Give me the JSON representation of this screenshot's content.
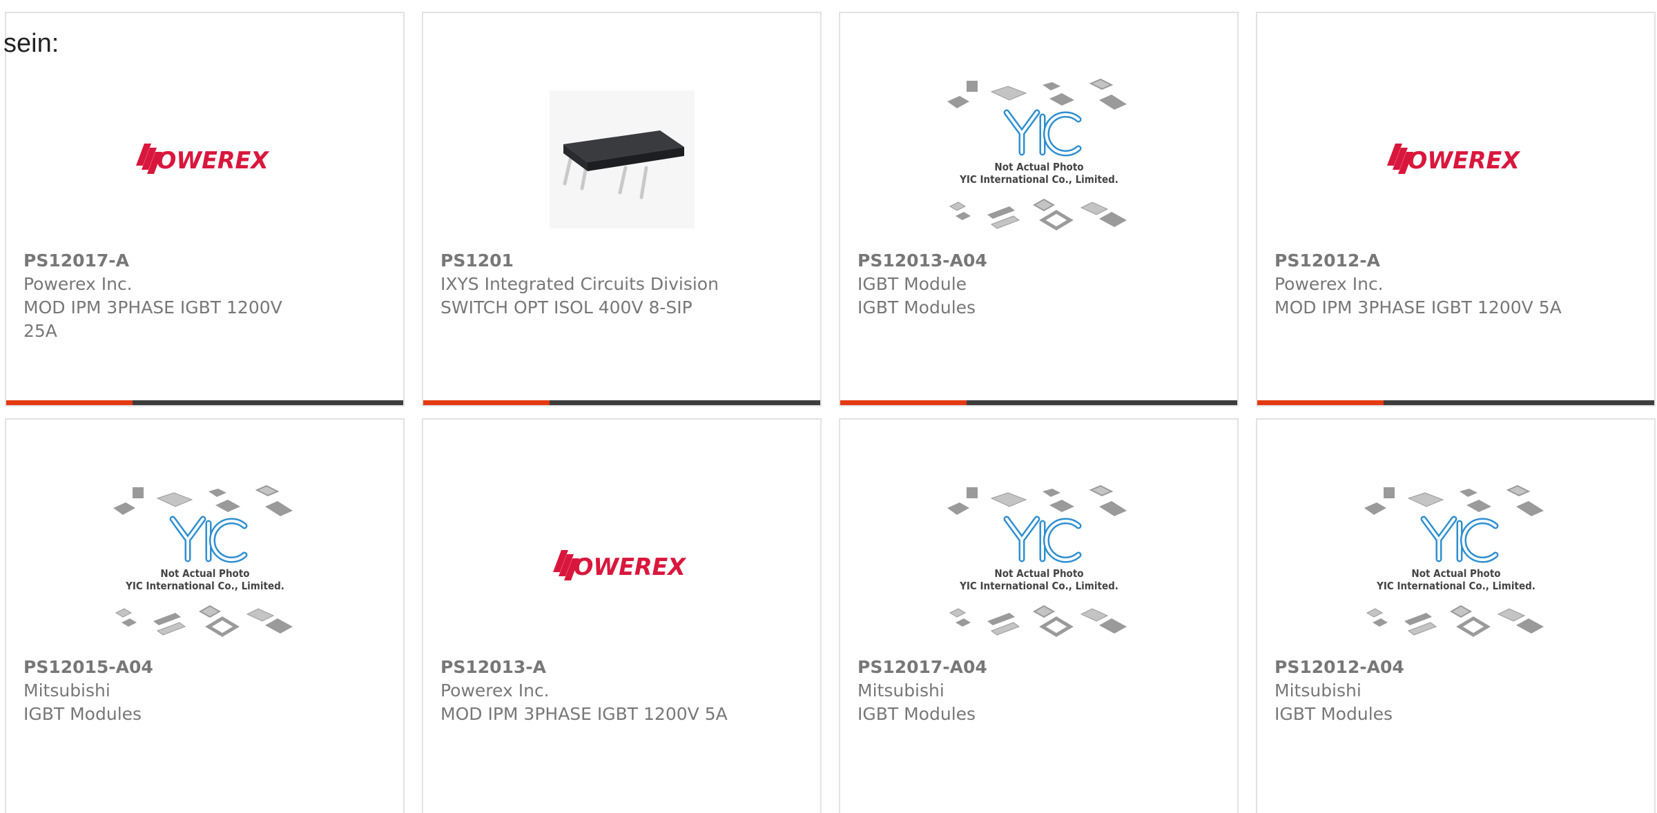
{
  "leading_text": "sein:",
  "products": [
    {
      "part": "PS12017-A",
      "lines": [
        "Powerex Inc.",
        "MOD IPM 3PHASE IGBT 1200V",
        "25A"
      ],
      "image": "powerex-logo",
      "image_text": "POWEREX"
    },
    {
      "part": "PS1201",
      "lines": [
        "IXYS Integrated Circuits Division",
        "SWITCH OPT ISOL 400V 8-SIP"
      ],
      "image": "sip-package-photo",
      "image_text": ""
    },
    {
      "part": "PS12013-A04",
      "lines": [
        "IGBT Module",
        "IGBT Modules"
      ],
      "image": "yic-placeholder",
      "image_text": "Not Actual Photo\nYIC International Co., Limited."
    },
    {
      "part": "PS12012-A",
      "lines": [
        "Powerex Inc.",
        "MOD IPM 3PHASE IGBT 1200V 5A"
      ],
      "image": "powerex-logo",
      "image_text": "POWEREX"
    },
    {
      "part": "PS12015-A04",
      "lines": [
        "Mitsubishi",
        "IGBT Modules"
      ],
      "image": "yic-placeholder",
      "image_text": "Not Actual Photo\nYIC International Co., Limited."
    },
    {
      "part": "PS12013-A",
      "lines": [
        "Powerex Inc.",
        "MOD IPM 3PHASE IGBT 1200V 5A"
      ],
      "image": "powerex-logo",
      "image_text": "POWEREX"
    },
    {
      "part": "PS12017-A04",
      "lines": [
        "Mitsubishi",
        "IGBT Modules"
      ],
      "image": "yic-placeholder",
      "image_text": "Not Actual Photo\nYIC International Co., Limited."
    },
    {
      "part": "PS12012-A04",
      "lines": [
        "Mitsubishi",
        "IGBT Modules"
      ],
      "image": "yic-placeholder",
      "image_text": "Not Actual Photo\nYIC International Co., Limited."
    }
  ],
  "colors": {
    "accent_bar": "#e33a13",
    "dark_bar": "#3d3d3d",
    "powerex_red": "#d9173d",
    "yic_blue": "#2f8fd0"
  }
}
